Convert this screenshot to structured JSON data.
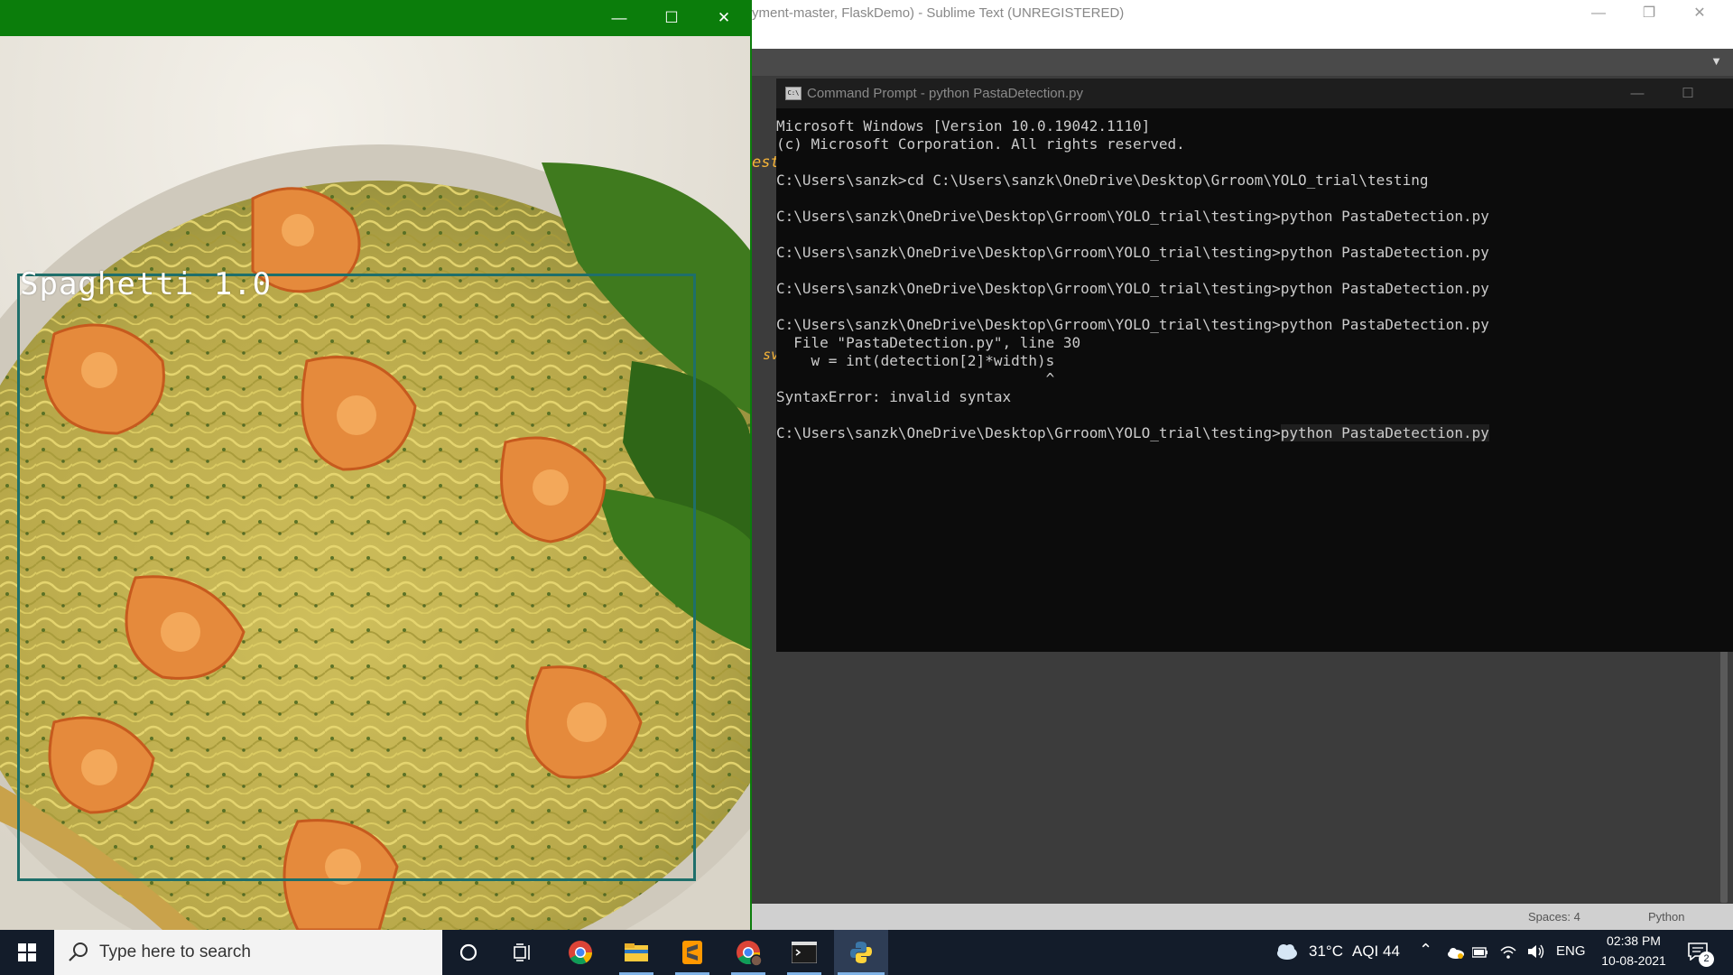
{
  "sublime": {
    "title": "yment-master, FlaskDemo) - Sublime Text (UNREGISTERED)",
    "code_fragment_1": "est",
    "code_fragment_2": "sv",
    "status_spaces": "Spaces: 4",
    "status_syntax": "Python"
  },
  "cmd": {
    "title": "Command Prompt - python  PastaDetection.py",
    "lines": [
      "Microsoft Windows [Version 10.0.19042.1110]",
      "(c) Microsoft Corporation. All rights reserved.",
      "",
      "C:\\Users\\sanzk>cd C:\\Users\\sanzk\\OneDrive\\Desktop\\Grroom\\YOLO_trial\\testing",
      "",
      "C:\\Users\\sanzk\\OneDrive\\Desktop\\Grroom\\YOLO_trial\\testing>python PastaDetection.py",
      "",
      "C:\\Users\\sanzk\\OneDrive\\Desktop\\Grroom\\YOLO_trial\\testing>python PastaDetection.py",
      "",
      "C:\\Users\\sanzk\\OneDrive\\Desktop\\Grroom\\YOLO_trial\\testing>python PastaDetection.py",
      "",
      "C:\\Users\\sanzk\\OneDrive\\Desktop\\Grroom\\YOLO_trial\\testing>python PastaDetection.py",
      "  File \"PastaDetection.py\", line 30",
      "    w = int(detection[2]*width)s",
      "                               ^",
      "SyntaxError: invalid syntax",
      "",
      "C:\\Users\\sanzk\\OneDrive\\Desktop\\Grroom\\YOLO_trial\\testing>python PastaDetection.py",
      ""
    ],
    "last_prompt": "C:\\Users\\sanzk\\OneDrive\\Desktop\\Grroom\\YOLO_trial\\testing>",
    "last_command": "python PastaDetection.py"
  },
  "viewer": {
    "detection_label": "Spaghetti 1.0",
    "box_color": "#1f6f6a",
    "titlebar_color": "#0b7d0b"
  },
  "taskbar": {
    "search_placeholder": "Type here to search",
    "apps": [
      "cortana-icon",
      "task-view-icon",
      "chrome-icon",
      "file-explorer-icon",
      "sublime-text-icon",
      "chrome-profile-icon",
      "command-prompt-icon",
      "python-icon"
    ],
    "weather": "31°C",
    "aqi": "AQI 44",
    "language": "ENG",
    "time": "02:38 PM",
    "date": "10-08-2021",
    "notification_count": "2"
  }
}
